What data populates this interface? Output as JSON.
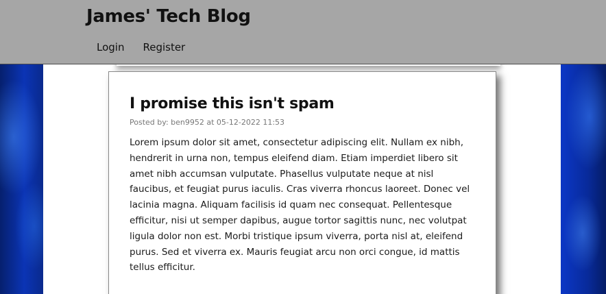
{
  "header": {
    "site_title": "James' Tech Blog",
    "nav": {
      "login": "Login",
      "register": "Register"
    }
  },
  "post": {
    "title": "I promise this isn't spam",
    "meta": "Posted by: ben9952 at 05-12-2022 11:53",
    "body": "Lorem ipsum dolor sit amet, consectetur adipiscing elit. Nullam ex nibh, hendrerit in urna non, tempus eleifend diam. Etiam imperdiet libero sit amet nibh accumsan vulputate. Phasellus vulputate neque at nisl faucibus, et feugiat purus iaculis. Cras viverra rhoncus laoreet. Donec vel lacinia magna. Aliquam facilisis id quam nec consequat. Pellentesque efficitur, nisi ut semper dapibus, augue tortor sagittis nunc, nec volutpat ligula dolor non est. Morbi tristique ipsum viverra, porta nisl at, eleifend purus. Sed et viverra ex. Mauris feugiat arcu non orci congue, id mattis tellus efficitur."
  },
  "colors": {
    "header_bg": "#a6a6a6",
    "background_accent": "#0b34b5",
    "card_bg": "#ffffff",
    "meta_text": "#777777"
  }
}
